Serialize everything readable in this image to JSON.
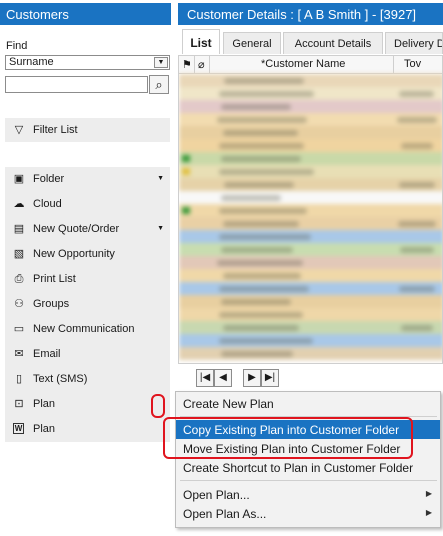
{
  "left_panel": {
    "title": "Customers",
    "find_label": "Find",
    "find_field": {
      "selected": "Surname",
      "options_visible": [
        "Surname"
      ]
    },
    "search_value": "",
    "filter_label": "Filter List",
    "items": [
      {
        "label": "Folder",
        "icon": "folder-icon",
        "dropdown": true
      },
      {
        "label": "Cloud",
        "icon": "cloud-icon",
        "dropdown": false
      },
      {
        "label": "New Quote/Order",
        "icon": "document-icon",
        "dropdown": true
      },
      {
        "label": "New Opportunity",
        "icon": "opportunity-icon",
        "dropdown": false
      },
      {
        "label": "Print List",
        "icon": "printer-icon",
        "dropdown": false
      },
      {
        "label": "Groups",
        "icon": "groups-icon",
        "dropdown": false
      },
      {
        "label": "New Communication",
        "icon": "chat-icon",
        "dropdown": false
      },
      {
        "label": "Email",
        "icon": "email-icon",
        "dropdown": false
      },
      {
        "label": "Text (SMS)",
        "icon": "phone-icon",
        "dropdown": false
      },
      {
        "label": "Plan",
        "icon": "plan-icon",
        "dropdown": false
      },
      {
        "label": "Plan",
        "icon": "word-plan-icon",
        "dropdown": false
      }
    ]
  },
  "right_panel": {
    "title": "Customer Details : [ A B Smith ]  -  [3927]",
    "tabs": [
      "List",
      "General",
      "Account Details",
      "Delivery D"
    ],
    "active_tab": "List",
    "columns": [
      "*Customer Name",
      "Tov"
    ],
    "rows_blurred": true
  },
  "context_menu": {
    "items": [
      {
        "label": "Create New Plan",
        "submenu": false,
        "highlighted": false
      },
      {
        "label": "Copy Existing Plan into Customer Folder",
        "submenu": false,
        "highlighted": true
      },
      {
        "label": "Move Existing Plan into Customer Folder",
        "submenu": false,
        "highlighted": false
      },
      {
        "label": "Create Shortcut to Plan in Customer Folder",
        "submenu": false,
        "highlighted": false
      },
      {
        "label": "Open Plan...",
        "submenu": true,
        "highlighted": false
      },
      {
        "label": "Open Plan As...",
        "submenu": true,
        "highlighted": false
      }
    ]
  },
  "colors": {
    "header_blue": "#1a73c2",
    "highlight_blue": "#1a73c2",
    "annotation_red": "#e0141e",
    "panel_grey": "#ededed"
  }
}
